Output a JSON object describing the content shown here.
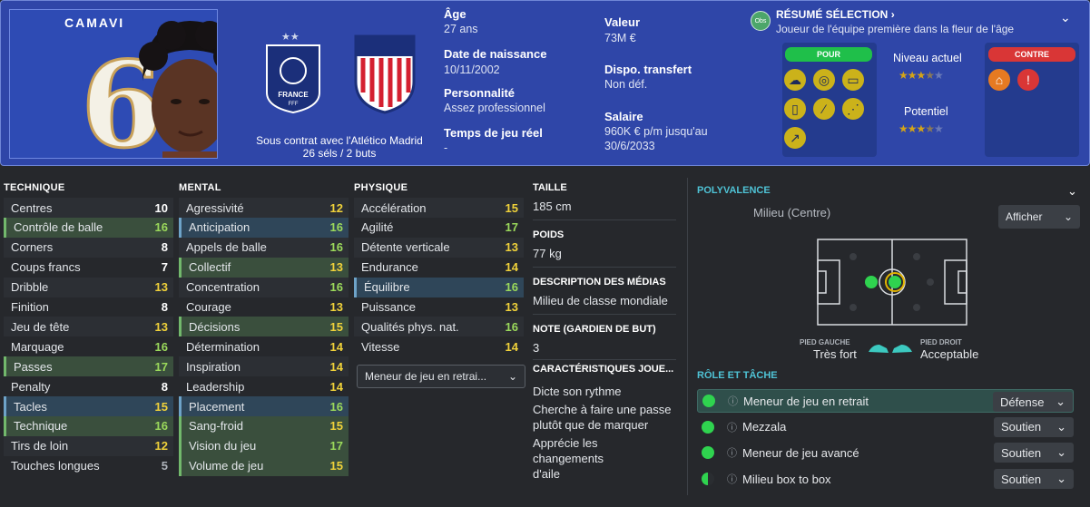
{
  "header": {
    "player_name": "CAMAVI",
    "shirt_number": "6",
    "contract_text": "Sous contrat avec l'Atlético Madrid",
    "caps_text": "26 séls / 2 buts",
    "france_text": "FRANCE",
    "france_sub": "FFF",
    "age_label": "Âge",
    "age_value": "27 ans",
    "dob_label": "Date de naissance",
    "dob_value": "10/11/2002",
    "personality_label": "Personnalité",
    "personality_value": "Assez professionnel",
    "playtime_label": "Temps de jeu réel",
    "playtime_value": "-",
    "value_label": "Valeur",
    "value_value": "73M €",
    "transfer_label": "Dispo. transfert",
    "transfer_value": "Non déf.",
    "salary_label": "Salaire",
    "salary_value_1": "960K € p/m jusqu'au",
    "salary_value_2": "30/6/2033"
  },
  "scout": {
    "obs": "Obs",
    "title": "RÉSUMÉ SÉLECTION",
    "subtitle": "Joueur de l'équipe première dans la fleur de l'âge",
    "pour_label": "POUR",
    "contre_label": "CONTRE",
    "current_label": "Niveau actuel",
    "potential_label": "Potentiel",
    "current_stars": 3.5,
    "potential_stars": 3.5,
    "pour_icons": [
      "brain-icon",
      "target-icon",
      "pitch-icon",
      "cards-icon",
      "shoe-icon",
      "passes-icon",
      "dribble-icon"
    ],
    "contre_icons": [
      "goal-icon",
      "ball-warning-icon"
    ]
  },
  "technique": {
    "title": "TECHNIQUE",
    "rows": [
      {
        "label": "Centres",
        "value": "10"
      },
      {
        "label": "Contrôle de balle",
        "value": "16"
      },
      {
        "label": "Corners",
        "value": "8"
      },
      {
        "label": "Coups francs",
        "value": "7"
      },
      {
        "label": "Dribble",
        "value": "13"
      },
      {
        "label": "Finition",
        "value": "8"
      },
      {
        "label": "Jeu de tête",
        "value": "13"
      },
      {
        "label": "Marquage",
        "value": "16"
      },
      {
        "label": "Passes",
        "value": "17"
      },
      {
        "label": "Penalty",
        "value": "8"
      },
      {
        "label": "Tacles",
        "value": "15"
      },
      {
        "label": "Technique",
        "value": "16"
      },
      {
        "label": "Tirs de loin",
        "value": "12"
      },
      {
        "label": "Touches longues",
        "value": "5"
      }
    ]
  },
  "mental": {
    "title": "MENTAL",
    "rows": [
      {
        "label": "Agressivité",
        "value": "12"
      },
      {
        "label": "Anticipation",
        "value": "16"
      },
      {
        "label": "Appels de balle",
        "value": "16"
      },
      {
        "label": "Collectif",
        "value": "13"
      },
      {
        "label": "Concentration",
        "value": "16"
      },
      {
        "label": "Courage",
        "value": "13"
      },
      {
        "label": "Décisions",
        "value": "15"
      },
      {
        "label": "Détermination",
        "value": "14"
      },
      {
        "label": "Inspiration",
        "value": "14"
      },
      {
        "label": "Leadership",
        "value": "14"
      },
      {
        "label": "Placement",
        "value": "16"
      },
      {
        "label": "Sang-froid",
        "value": "15"
      },
      {
        "label": "Vision du jeu",
        "value": "17"
      },
      {
        "label": "Volume de jeu",
        "value": "15"
      }
    ]
  },
  "physique": {
    "title": "PHYSIQUE",
    "rows": [
      {
        "label": "Accélération",
        "value": "15"
      },
      {
        "label": "Agilité",
        "value": "17"
      },
      {
        "label": "Détente verticale",
        "value": "13"
      },
      {
        "label": "Endurance",
        "value": "14"
      },
      {
        "label": "Équilibre",
        "value": "16"
      },
      {
        "label": "Puissance",
        "value": "13"
      },
      {
        "label": "Qualités phys. nat.",
        "value": "16"
      },
      {
        "label": "Vitesse",
        "value": "14"
      }
    ],
    "role_select": "Meneur de jeu en retrai..."
  },
  "info": {
    "height_label": "TAILLE",
    "height_value": "185 cm",
    "weight_label": "POIDS",
    "weight_value": "77 kg",
    "media_label": "DESCRIPTION DES MÉDIAS",
    "media_value": "Milieu de classe mondiale",
    "gk_label": "NOTE (GARDIEN DE BUT)",
    "gk_value": "3",
    "traits_label": "CARACTÉRISTIQUES JOUE...",
    "traits": [
      "Dicte son rythme",
      "Cherche à faire une passe plutôt que de marquer",
      "Apprécie les changements d'aile"
    ]
  },
  "polyvalence": {
    "title": "POLYVALENCE",
    "position": "Milieu (Centre)",
    "show_button": "Afficher",
    "left_foot_label": "PIED GAUCHE",
    "left_foot_value": "Très fort",
    "right_foot_label": "PIED DROIT",
    "right_foot_value": "Acceptable"
  },
  "roles": {
    "title": "RÔLE ET TÂCHE",
    "items": [
      {
        "name": "Meneur de jeu en retrait",
        "duty": "Défense"
      },
      {
        "name": "Mezzala",
        "duty": "Soutien"
      },
      {
        "name": "Meneur de jeu avancé",
        "duty": "Soutien"
      },
      {
        "name": "Milieu box to box",
        "duty": "Soutien"
      }
    ]
  },
  "colors": {
    "header_bg": "#2f46a8",
    "accent_green": "#2fd34f",
    "accent_teal": "#4fc3d6",
    "pour": "#1fbf4a",
    "contre": "#d93636"
  }
}
